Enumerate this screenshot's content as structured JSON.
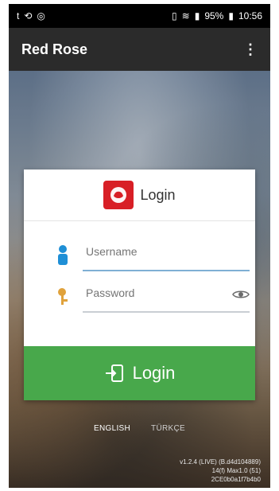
{
  "status_bar": {
    "left_icons": [
      "t-icon",
      "sync-icon",
      "target-icon"
    ],
    "battery_percent": "95%",
    "time": "10:56"
  },
  "app_bar": {
    "title": "Red Rose",
    "overflow_icon": "⋮"
  },
  "login_card": {
    "title": "Login",
    "username_placeholder": "Username",
    "password_placeholder": "Password",
    "login_button_label": "Login"
  },
  "language": {
    "english": "ENGLISH",
    "turkce": "TÜRKÇE"
  },
  "version": {
    "line1": "v1.2.4 (LIVE) (B.d4d104889)",
    "line2": "14(f) Max1.0 (51)",
    "line3": "2CE0b0a1f7b4b0"
  },
  "colors": {
    "brand_red": "#d81f26",
    "login_green": "#48a84b",
    "user_blue": "#1f8fd6",
    "key_orange": "#e0a23c"
  }
}
